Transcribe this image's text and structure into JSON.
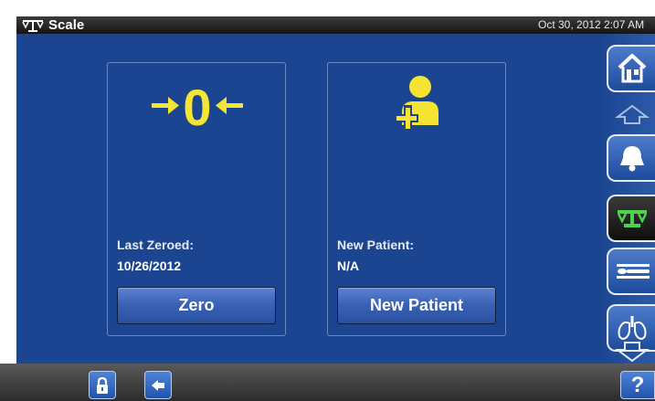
{
  "header": {
    "title": "Scale",
    "datetime": "Oct 30, 2012 2:07 AM"
  },
  "cards": {
    "zero": {
      "icon_text": "0",
      "label": "Last Zeroed:",
      "value": "10/26/2012",
      "button": "Zero"
    },
    "patient": {
      "label": "New Patient:",
      "value": "N/A",
      "button": "New Patient"
    }
  },
  "rail": {
    "items": [
      "home-icon",
      "bell-icon",
      "scale-icon",
      "bed-icon",
      "lungs-icon"
    ],
    "active": "scale-icon"
  },
  "footer": {
    "help_glyph": "?"
  },
  "colors": {
    "panel": "#1b4591",
    "accent": "#f5e431",
    "button": "#3a63b8"
  }
}
